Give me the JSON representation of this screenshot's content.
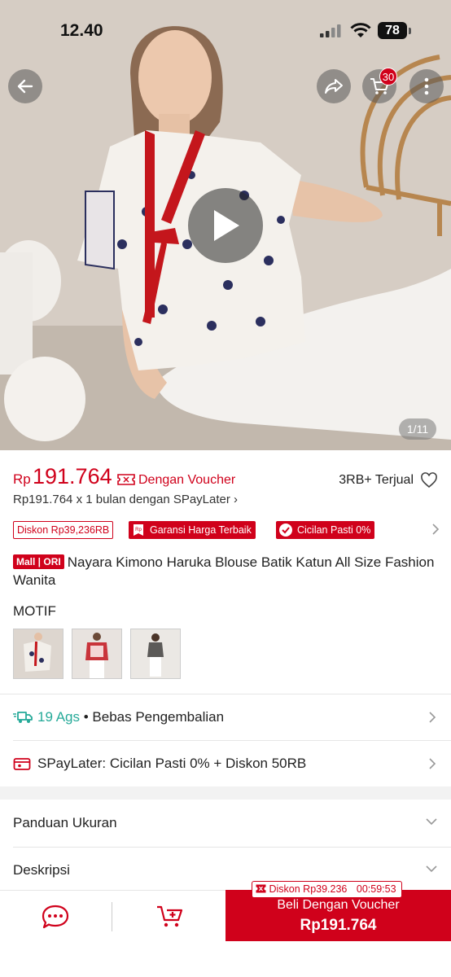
{
  "status_bar": {
    "time": "12.40",
    "battery": "78"
  },
  "gallery": {
    "counter": "1/11",
    "cart_count": "30"
  },
  "price": {
    "currency": "Rp",
    "value": "191.764",
    "voucher_label": "Dengan Voucher",
    "sold": "3RB+ Terjual",
    "spaylater_line": "Rp191.764 x 1 bulan dengan SPayLater ›"
  },
  "tags": {
    "discount": "Diskon Rp39,236RB",
    "guarantee": "Garansi Harga Terbaik",
    "installment": "Cicilan Pasti 0%"
  },
  "product": {
    "badge_mall": "Mall",
    "badge_ori": "ORI",
    "title": "Nayara Kimono Haruka Blouse Batik Katun All Size Fashion Wanita"
  },
  "variants": {
    "label": "MOTIF"
  },
  "shipping": {
    "date": "19 Ags",
    "returns": "• Bebas Pengembalian"
  },
  "spaylater": {
    "text": "SPayLater: Cicilan Pasti 0% + Diskon 50RB"
  },
  "sections": {
    "size_guide": "Panduan Ukuran",
    "description": "Deskripsi"
  },
  "bottom_bar": {
    "discount_timer": "Diskon Rp39.236",
    "timer": "00:59:53",
    "buy_label": "Beli Dengan Voucher",
    "buy_price": "Rp191.764"
  },
  "colors": {
    "accent": "#d0011b",
    "teal": "#26aa99"
  }
}
